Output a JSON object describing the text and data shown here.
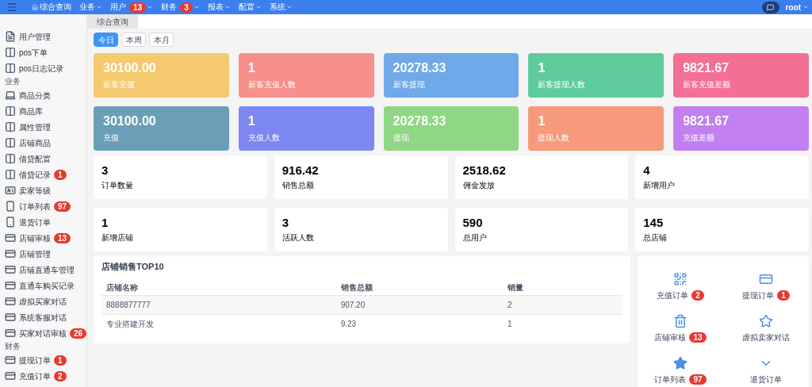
{
  "topbar": {
    "nav": [
      {
        "label": "综合查询",
        "kind": "home"
      },
      {
        "label": "业务",
        "kind": "menu"
      },
      {
        "label": "用户",
        "kind": "menu",
        "badge": "13"
      },
      {
        "label": "财务",
        "kind": "menu",
        "badge": "3"
      },
      {
        "label": "报表",
        "kind": "menu"
      },
      {
        "label": "配置",
        "kind": "menu"
      },
      {
        "label": "系统",
        "kind": "menu"
      }
    ],
    "user": "root"
  },
  "sidebar": {
    "items": [
      {
        "label": "用户管理",
        "kind": "page"
      },
      {
        "label": "pos下单",
        "kind": "columns"
      },
      {
        "label": "pos日志记录",
        "kind": "columns"
      },
      {
        "label": "业务",
        "kind": "section"
      },
      {
        "label": "商品分类",
        "kind": "laptop"
      },
      {
        "label": "商品库",
        "kind": "columns"
      },
      {
        "label": "属性管理",
        "kind": "columns"
      },
      {
        "label": "店铺商品",
        "kind": "columns"
      },
      {
        "label": "借贷配置",
        "kind": "columns"
      },
      {
        "label": "借贷记录",
        "kind": "columns",
        "badge": "1"
      },
      {
        "label": "卖家等级",
        "kind": "idcard"
      },
      {
        "label": "订单列表",
        "kind": "phone",
        "badge": "97"
      },
      {
        "label": "退货订单",
        "kind": "phone"
      },
      {
        "label": "店铺审核",
        "kind": "card",
        "badge": "13"
      },
      {
        "label": "店铺管理",
        "kind": "card"
      },
      {
        "label": "店铺直通车管理",
        "kind": "card"
      },
      {
        "label": "直通车购买记录",
        "kind": "card"
      },
      {
        "label": "虚拟买家对话",
        "kind": "card"
      },
      {
        "label": "系统客服对话",
        "kind": "card"
      },
      {
        "label": "买家对话审核",
        "kind": "card",
        "badge": "26"
      },
      {
        "label": "财务",
        "kind": "section"
      },
      {
        "label": "提现订单",
        "kind": "card",
        "badge": "1"
      },
      {
        "label": "充值订单",
        "kind": "card",
        "badge": "2"
      }
    ]
  },
  "tabs": [
    {
      "label": "综合查询",
      "selected": true
    }
  ],
  "periods": [
    {
      "label": "今日",
      "selected": true
    },
    {
      "label": "本周",
      "selected": false
    },
    {
      "label": "本月",
      "selected": false
    }
  ],
  "color_cards": [
    {
      "value": "30100.00",
      "label": "新客充值",
      "color": "#f6c96f"
    },
    {
      "value": "1",
      "label": "新客充值人数",
      "color": "#f7908a"
    },
    {
      "value": "20278.33",
      "label": "新客提现",
      "color": "#6fa9e9"
    },
    {
      "value": "1",
      "label": "新客提现人数",
      "color": "#5ecb9a"
    },
    {
      "value": "9821.67",
      "label": "新客充值差额",
      "color": "#f46f94"
    },
    {
      "value": "30100.00",
      "label": "充值",
      "color": "#6b9fb8"
    },
    {
      "value": "1",
      "label": "充值人数",
      "color": "#7c87f1"
    },
    {
      "value": "20278.33",
      "label": "提现",
      "color": "#8fd784"
    },
    {
      "value": "1",
      "label": "提现人数",
      "color": "#f69a7b"
    },
    {
      "value": "9821.67",
      "label": "充值差额",
      "color": "#c27ff1"
    }
  ],
  "stats": [
    {
      "value": "3",
      "label": "订单数量"
    },
    {
      "value": "916.42",
      "label": "销售总额"
    },
    {
      "value": "2518.62",
      "label": "佣金发放"
    },
    {
      "value": "4",
      "label": "新增用户"
    },
    {
      "value": "1",
      "label": "新增店铺"
    },
    {
      "value": "3",
      "label": "活跃人数"
    },
    {
      "value": "590",
      "label": "总用户"
    },
    {
      "value": "145",
      "label": "总店铺"
    }
  ],
  "table": {
    "title": "店铺销售TOP10",
    "columns": [
      "店铺名称",
      "销售总额",
      "销量"
    ],
    "rows": [
      [
        "8888877777",
        "907.20",
        "2"
      ],
      [
        "专业搭建开发",
        "9.23",
        "1"
      ]
    ]
  },
  "shortcuts": [
    {
      "label": "充值订单",
      "kind": "qrcode",
      "badge": "2"
    },
    {
      "label": "提现订单",
      "kind": "card",
      "badge": "1"
    },
    {
      "label": "店铺审核",
      "kind": "trash",
      "badge": "13"
    },
    {
      "label": "虚拟卖家对话",
      "kind": "star-outline"
    },
    {
      "label": "订单列表",
      "kind": "star",
      "badge": "97"
    },
    {
      "label": "退货订单",
      "kind": "chevron"
    }
  ]
}
